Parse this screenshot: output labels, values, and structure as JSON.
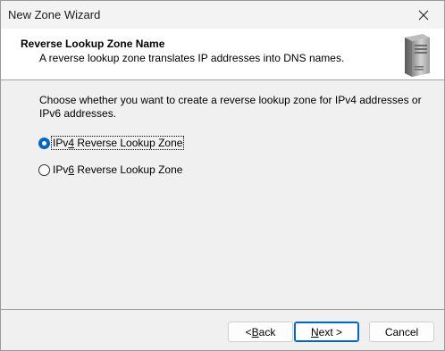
{
  "window": {
    "title": "New Zone Wizard"
  },
  "header": {
    "title": "Reverse Lookup Zone Name",
    "description": "A reverse lookup zone translates IP addresses into DNS names.",
    "icon": "server-icon"
  },
  "main": {
    "prompt": "Choose whether you want to create a reverse lookup zone for IPv4 addresses or IPv6 addresses.",
    "options": [
      {
        "pre": "IPv",
        "accel": "4",
        "post": " Reverse Lookup Zone",
        "selected": true
      },
      {
        "pre": "IPv",
        "accel": "6",
        "post": " Reverse Lookup Zone",
        "selected": false
      }
    ]
  },
  "buttons": {
    "back": {
      "pre": "< ",
      "accel": "B",
      "post": "ack"
    },
    "next": {
      "pre": "",
      "accel": "N",
      "post": "ext >"
    },
    "cancel": {
      "label": "Cancel"
    }
  },
  "colors": {
    "accent": "#0067c0",
    "header_bg": "#ffffff",
    "dialog_bg": "#f0f0f0"
  }
}
